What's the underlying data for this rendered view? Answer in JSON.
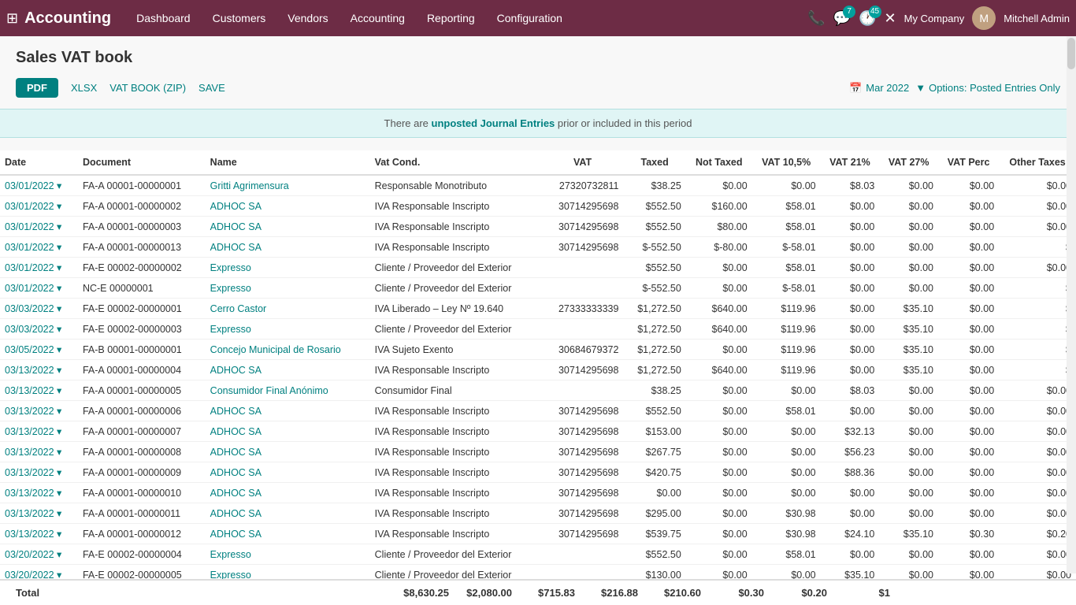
{
  "app": {
    "grid_icon": "⊞",
    "brand": "Accounting",
    "menu": [
      {
        "label": "Dashboard",
        "id": "dashboard"
      },
      {
        "label": "Customers",
        "id": "customers"
      },
      {
        "label": "Vendors",
        "id": "vendors"
      },
      {
        "label": "Accounting",
        "id": "accounting"
      },
      {
        "label": "Reporting",
        "id": "reporting"
      },
      {
        "label": "Configuration",
        "id": "configuration"
      }
    ]
  },
  "topnav_right": {
    "phone_icon": "📞",
    "chat_badge": "7",
    "clock_badge": "45",
    "close_icon": "✕",
    "company": "My Company",
    "user": "Mitchell Admin"
  },
  "page": {
    "title": "Sales VAT book",
    "toolbar": {
      "pdf_label": "PDF",
      "xlsx_label": "XLSX",
      "vat_book_label": "VAT BOOK (ZIP)",
      "save_label": "SAVE",
      "period": "Mar 2022",
      "options": "Options: Posted Entries Only"
    },
    "info_banner": {
      "text_before": "There are ",
      "highlight": "unposted Journal Entries",
      "text_after": " prior or included in this period"
    }
  },
  "table": {
    "headers": [
      "Date",
      "Document",
      "Name",
      "Vat Cond.",
      "VAT",
      "Taxed",
      "Not Taxed",
      "VAT 10,5%",
      "VAT 21%",
      "VAT 27%",
      "VAT Perc",
      "Other Taxes"
    ],
    "rows": [
      [
        "03/01/2022",
        "FA-A 00001-00000001",
        "Gritti Agrimensura",
        "Responsable Monotributo",
        "27320732811",
        "$38.25",
        "$0.00",
        "$0.00",
        "$8.03",
        "$0.00",
        "$0.00",
        "$0.00"
      ],
      [
        "03/01/2022",
        "FA-A 00001-00000002",
        "ADHOC SA",
        "IVA Responsable Inscripto",
        "30714295698",
        "$552.50",
        "$160.00",
        "$58.01",
        "$0.00",
        "$0.00",
        "$0.00",
        "$0.00"
      ],
      [
        "03/01/2022",
        "FA-A 00001-00000003",
        "ADHOC SA",
        "IVA Responsable Inscripto",
        "30714295698",
        "$552.50",
        "$80.00",
        "$58.01",
        "$0.00",
        "$0.00",
        "$0.00",
        "$0.00"
      ],
      [
        "03/01/2022",
        "FA-A 00001-00000013",
        "ADHOC SA",
        "IVA Responsable Inscripto",
        "30714295698",
        "$-552.50",
        "$-80.00",
        "$-58.01",
        "$0.00",
        "$0.00",
        "$0.00",
        "$"
      ],
      [
        "03/01/2022",
        "FA-E 00002-00000002",
        "Expresso",
        "Cliente / Proveedor del Exterior",
        "",
        "$552.50",
        "$0.00",
        "$58.01",
        "$0.00",
        "$0.00",
        "$0.00",
        "$0.00"
      ],
      [
        "03/01/2022",
        "NC-E 00000001",
        "Expresso",
        "Cliente / Proveedor del Exterior",
        "",
        "$-552.50",
        "$0.00",
        "$-58.01",
        "$0.00",
        "$0.00",
        "$0.00",
        "$"
      ],
      [
        "03/03/2022",
        "FA-E 00002-00000001",
        "Cerro Castor",
        "IVA Liberado – Ley Nº 19.640",
        "27333333339",
        "$1,272.50",
        "$640.00",
        "$119.96",
        "$0.00",
        "$35.10",
        "$0.00",
        "$"
      ],
      [
        "03/03/2022",
        "FA-E 00002-00000003",
        "Expresso",
        "Cliente / Proveedor del Exterior",
        "",
        "$1,272.50",
        "$640.00",
        "$119.96",
        "$0.00",
        "$35.10",
        "$0.00",
        "$"
      ],
      [
        "03/05/2022",
        "FA-B 00001-00000001",
        "Concejo Municipal de Rosario",
        "IVA Sujeto Exento",
        "30684679372",
        "$1,272.50",
        "$0.00",
        "$119.96",
        "$0.00",
        "$35.10",
        "$0.00",
        "$"
      ],
      [
        "03/13/2022",
        "FA-A 00001-00000004",
        "ADHOC SA",
        "IVA Responsable Inscripto",
        "30714295698",
        "$1,272.50",
        "$640.00",
        "$119.96",
        "$0.00",
        "$35.10",
        "$0.00",
        "$"
      ],
      [
        "03/13/2022",
        "FA-A 00001-00000005",
        "Consumidor Final Anónimo",
        "Consumidor Final",
        "",
        "$38.25",
        "$0.00",
        "$0.00",
        "$8.03",
        "$0.00",
        "$0.00",
        "$0.00"
      ],
      [
        "03/13/2022",
        "FA-A 00001-00000006",
        "ADHOC SA",
        "IVA Responsable Inscripto",
        "30714295698",
        "$552.50",
        "$0.00",
        "$58.01",
        "$0.00",
        "$0.00",
        "$0.00",
        "$0.00"
      ],
      [
        "03/13/2022",
        "FA-A 00001-00000007",
        "ADHOC SA",
        "IVA Responsable Inscripto",
        "30714295698",
        "$153.00",
        "$0.00",
        "$0.00",
        "$32.13",
        "$0.00",
        "$0.00",
        "$0.00"
      ],
      [
        "03/13/2022",
        "FA-A 00001-00000008",
        "ADHOC SA",
        "IVA Responsable Inscripto",
        "30714295698",
        "$267.75",
        "$0.00",
        "$0.00",
        "$56.23",
        "$0.00",
        "$0.00",
        "$0.00"
      ],
      [
        "03/13/2022",
        "FA-A 00001-00000009",
        "ADHOC SA",
        "IVA Responsable Inscripto",
        "30714295698",
        "$420.75",
        "$0.00",
        "$0.00",
        "$88.36",
        "$0.00",
        "$0.00",
        "$0.00"
      ],
      [
        "03/13/2022",
        "FA-A 00001-00000010",
        "ADHOC SA",
        "IVA Responsable Inscripto",
        "30714295698",
        "$0.00",
        "$0.00",
        "$0.00",
        "$0.00",
        "$0.00",
        "$0.00",
        "$0.00"
      ],
      [
        "03/13/2022",
        "FA-A 00001-00000011",
        "ADHOC SA",
        "IVA Responsable Inscripto",
        "30714295698",
        "$295.00",
        "$0.00",
        "$30.98",
        "$0.00",
        "$0.00",
        "$0.00",
        "$0.00"
      ],
      [
        "03/13/2022",
        "FA-A 00001-00000012",
        "ADHOC SA",
        "IVA Responsable Inscripto",
        "30714295698",
        "$539.75",
        "$0.00",
        "$30.98",
        "$24.10",
        "$35.10",
        "$0.30",
        "$0.20"
      ],
      [
        "03/20/2022",
        "FA-E 00002-00000004",
        "Expresso",
        "Cliente / Proveedor del Exterior",
        "",
        "$552.50",
        "$0.00",
        "$58.01",
        "$0.00",
        "$0.00",
        "$0.00",
        "$0.00"
      ],
      [
        "03/20/2022",
        "FA-E 00002-00000005",
        "Expresso",
        "Cliente / Proveedor del Exterior",
        "",
        "$130.00",
        "$0.00",
        "$0.00",
        "$35.10",
        "$0.00",
        "$0.00",
        "$0.00"
      ]
    ],
    "total": {
      "label": "Total",
      "taxed": "$8,630.25",
      "not_taxed": "$2,080.00",
      "vat_10_5": "$715.83",
      "vat_21": "$216.88",
      "vat_27": "$210.60",
      "vat_perc": "$0.30",
      "other_taxes": "$0.20",
      "extra": "$1"
    }
  }
}
